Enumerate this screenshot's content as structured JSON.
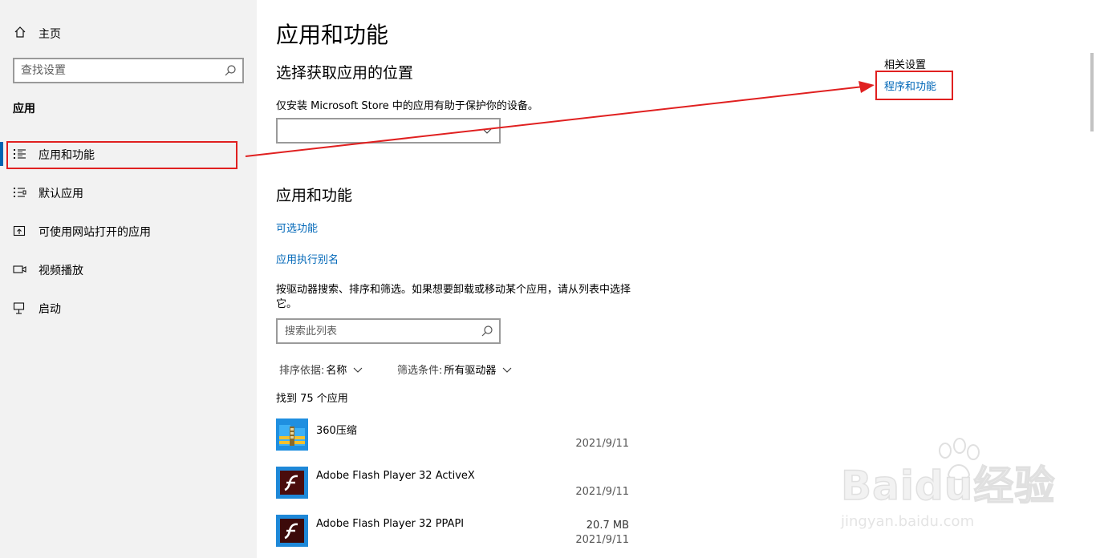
{
  "sidebar": {
    "home_label": "主页",
    "search_placeholder": "查找设置",
    "section_title": "应用",
    "items": [
      {
        "label": "应用和功能",
        "selected": true
      },
      {
        "label": "默认应用"
      },
      {
        "label": "可使用网站打开的应用"
      },
      {
        "label": "视频播放"
      },
      {
        "label": "启动"
      }
    ]
  },
  "main": {
    "title": "应用和功能",
    "choose_location": {
      "heading": "选择获取应用的位置",
      "description": "仅安装 Microsoft Store 中的应用有助于保护你的设备。",
      "dropdown_value": ""
    },
    "apps_section": {
      "heading": "应用和功能",
      "optional_features_link": "可选功能",
      "execution_alias_link": "应用执行别名",
      "description": "按驱动器搜索、排序和筛选。如果想要卸载或移动某个应用，请从列表中选择它。",
      "search_placeholder": "搜索此列表",
      "sort_label": "排序依据:",
      "sort_value": "名称",
      "filter_label": "筛选条件:",
      "filter_value": "所有驱动器",
      "count_text": "找到 75 个应用",
      "apps": [
        {
          "name": "360压缩",
          "size": "",
          "date": "2021/9/11"
        },
        {
          "name": "Adobe Flash Player 32 ActiveX",
          "size": "",
          "date": "2021/9/11"
        },
        {
          "name": "Adobe Flash Player 32 PPAPI",
          "size": "20.7 MB",
          "date": "2021/9/11"
        }
      ]
    }
  },
  "related": {
    "title": "相关设置",
    "programs_link": "程序和功能"
  },
  "watermark": {
    "brand": "Baidu经验",
    "url": "jingyan.baidu.com"
  },
  "colors": {
    "accent": "#0063b1",
    "link": "#0067b8",
    "annotation": "#e02020",
    "sidebar_bg": "#f2f2f2"
  }
}
